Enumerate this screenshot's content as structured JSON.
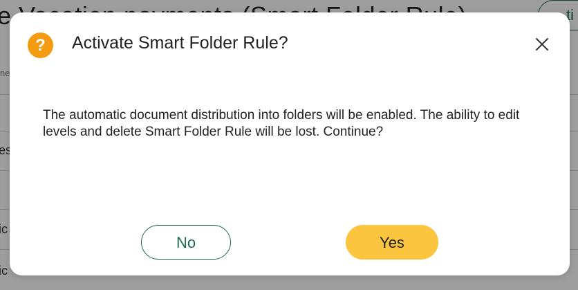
{
  "background": {
    "title": "e  Vacation payments (Smart Folder Rule)",
    "action_button": "ti",
    "subtext": "ne",
    "rows": [
      {
        "label": "es"
      },
      {
        "label": "ic"
      },
      {
        "label": "ic"
      }
    ]
  },
  "dialog": {
    "icon": "question-icon",
    "icon_glyph": "?",
    "icon_color": "#f39c12",
    "title": "Activate Smart Folder Rule?",
    "close_icon": "close-icon",
    "message": "The automatic document distribution into folders will be enabled. The ability to edit levels and delete Smart Folder Rule will be lost. Continue?",
    "no_label": "No",
    "yes_label": "Yes",
    "accent_color": "#1e6b4c",
    "primary_color": "#fcc540"
  }
}
